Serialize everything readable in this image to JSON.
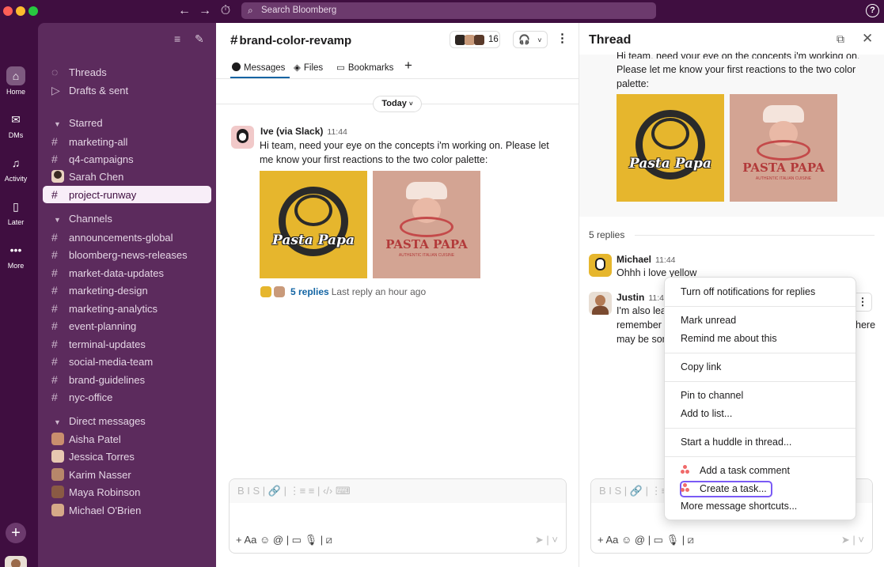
{
  "titlebar": {
    "search_placeholder": "Search Bloomberg",
    "back": "←",
    "forward": "→",
    "history": "⏱",
    "help": "?"
  },
  "rail": {
    "items": [
      {
        "label": "Home",
        "icon": "home-icon"
      },
      {
        "label": "DMs",
        "icon": "dms-icon"
      },
      {
        "label": "Activity",
        "icon": "bell-icon"
      },
      {
        "label": "Later",
        "icon": "bookmark-icon"
      },
      {
        "label": "More",
        "icon": "more-icon"
      }
    ],
    "add": "+"
  },
  "sidebar": {
    "top": [
      {
        "label": "Threads"
      },
      {
        "label": "Drafts & sent"
      }
    ],
    "starred_header": "Starred",
    "starred": [
      {
        "label": "marketing-all",
        "type": "channel"
      },
      {
        "label": "q4-campaigns",
        "type": "channel"
      },
      {
        "label": "Sarah Chen",
        "type": "dm"
      },
      {
        "label": "project-runway",
        "type": "channel",
        "active": true
      }
    ],
    "channels_header": "Channels",
    "channels": [
      "announcements-global",
      "bloomberg-news-releases",
      "market-data-updates",
      "marketing-design",
      "marketing-analytics",
      "event-planning",
      "terminal-updates",
      "social-media-team",
      "brand-guidelines",
      "nyc-office"
    ],
    "dms_header": "Direct messages",
    "dms": [
      "Aisha Patel",
      "Jessica Torres",
      "Karim Nasser",
      "Maya Robinson",
      "Michael O'Brien"
    ]
  },
  "channel": {
    "hash": "#",
    "name": "brand-color-revamp",
    "member_count": "16",
    "tabs": [
      "Messages",
      "Files",
      "Bookmarks"
    ],
    "tab_add": "+",
    "date_divider": "Today",
    "message": {
      "author": "Ive (via Slack)",
      "time": "11:44",
      "text": "Hi team, need your eye on the concepts i'm working on. Please let me know your first reactions to the two color palette:",
      "image1_title": "Pasta Papa",
      "image2_title": "PASTA PAPA",
      "image2_sub": "AUTHENTIC ITALIAN CUISINE",
      "replies": "5 replies",
      "last_reply": "Last reply an hour ago"
    }
  },
  "composer": {
    "format": "B   I   S   |   🔗   |   ⋮≡  ≡   |   ‹/›  ⌨",
    "tools": "+   Aa   ☺   @   |   ▭   🎙   |   ⧄",
    "send": "➤  |  ˅"
  },
  "thread": {
    "title": "Thread",
    "parent_text_partial": "Hi team, need your eye on the concepts i'm working on.",
    "parent_text": "Please let me know your first reactions to the two color palette:",
    "reply_count": "5 replies",
    "replies": [
      {
        "author": "Michael",
        "time": "11:44",
        "text": "Ohhh i love yellow"
      },
      {
        "author": "Justin",
        "time": "11:44",
        "lines": [
          "I'm also lean",
          "remember o",
          "may be som"
        ],
        "tail": "here"
      }
    ]
  },
  "context_menu": {
    "groups": [
      [
        "Turn off notifications for replies"
      ],
      [
        "Mark unread",
        "Remind me about this"
      ],
      [
        "Copy link"
      ],
      [
        "Pin to channel",
        "Add to list..."
      ],
      [
        "Start a huddle in thread..."
      ],
      [
        "Add a task comment",
        "Create a task...",
        "More message shortcuts..."
      ]
    ]
  }
}
